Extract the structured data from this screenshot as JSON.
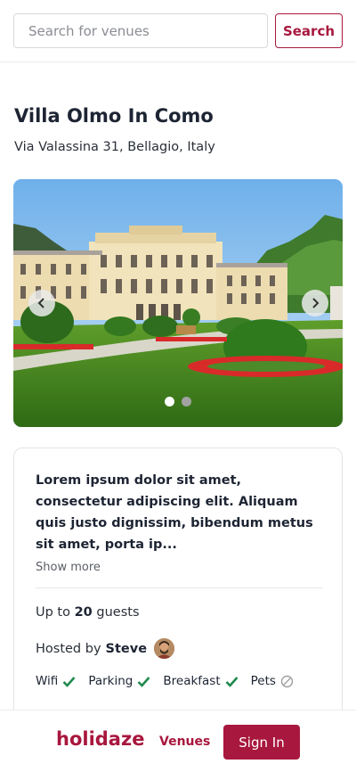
{
  "search": {
    "placeholder": "Search for venues",
    "value": "",
    "button_label": "Search"
  },
  "venue": {
    "title": "Villa Olmo In Como",
    "address": "Via Valassina 31, Bellagio, Italy",
    "description": "Lorem ipsum dolor sit amet, consectetur adipiscing elit. Aliquam quis justo dignissim, bibendum metus sit amet, porta ip...",
    "show_more_label": "Show more",
    "guests_prefix": "Up to",
    "guests_count": "20",
    "guests_suffix": "guests",
    "hosted_prefix": "Hosted by",
    "host_name": "Steve",
    "amenities": [
      {
        "label": "Wifi",
        "available": true,
        "icon": "check-icon"
      },
      {
        "label": "Parking",
        "available": true,
        "icon": "check-icon"
      },
      {
        "label": "Breakfast",
        "available": true,
        "icon": "check-icon"
      },
      {
        "label": "Pets",
        "available": false,
        "icon": "not-allowed-icon"
      }
    ]
  },
  "carousel": {
    "slide_count": 2,
    "active_index": 0
  },
  "footer": {
    "logo": "holidaze",
    "venues_label": "Venues",
    "signin_label": "Sign In"
  },
  "colors": {
    "brand": "#a8173d",
    "check": "#1f8a4c",
    "muted": "#a0a0a0"
  }
}
